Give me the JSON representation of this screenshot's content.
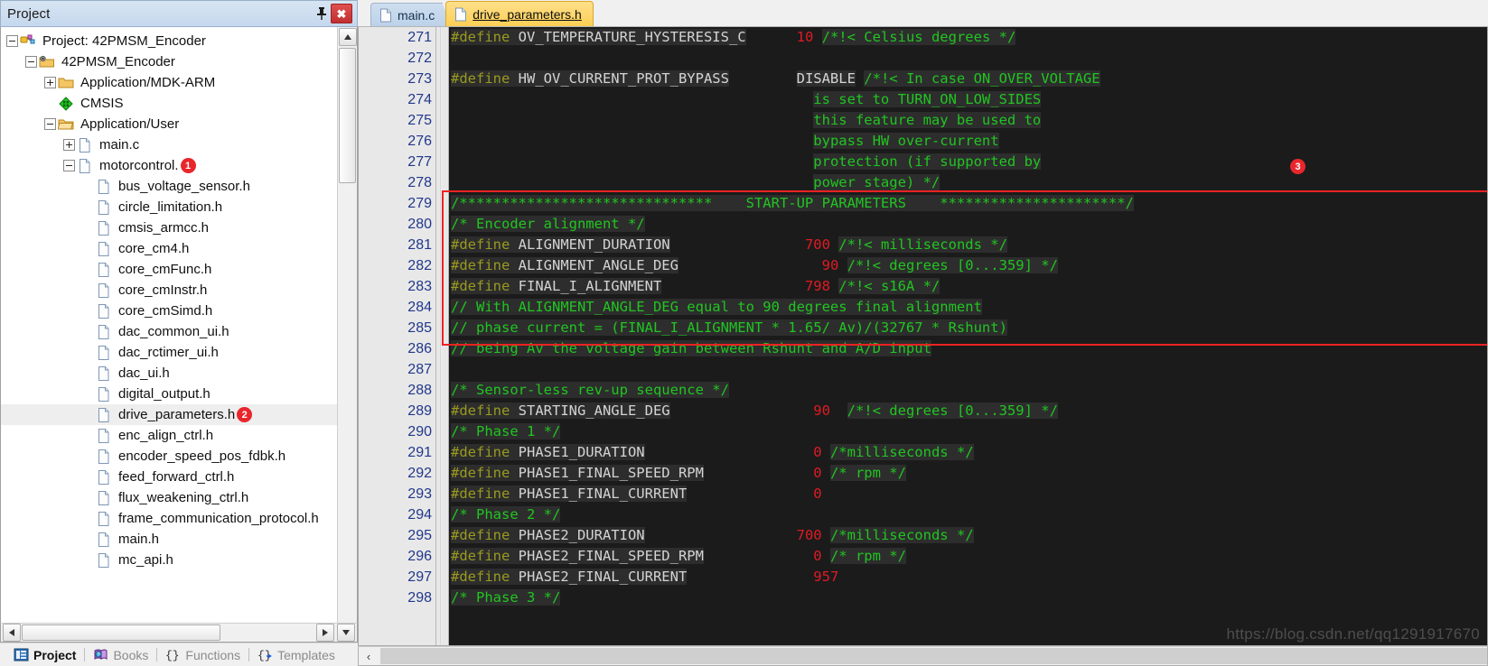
{
  "project_panel": {
    "title": "Project",
    "pin_icon": "pin-icon",
    "close_label": "✖",
    "tree": [
      {
        "depth": 0,
        "expander": "minus",
        "icon": "project-icon",
        "label": "Project: 42PMSM_Encoder"
      },
      {
        "depth": 1,
        "expander": "minus",
        "icon": "target-folder-icon",
        "label": "42PMSM_Encoder"
      },
      {
        "depth": 2,
        "expander": "plus",
        "icon": "folder-icon",
        "label": "Application/MDK-ARM"
      },
      {
        "depth": 2,
        "expander": "none",
        "icon": "cmsis-icon",
        "label": "CMSIS"
      },
      {
        "depth": 2,
        "expander": "minus",
        "icon": "folder-open-icon",
        "label": "Application/User"
      },
      {
        "depth": 3,
        "expander": "plus",
        "icon": "file-icon",
        "label": "main.c"
      },
      {
        "depth": 3,
        "expander": "minus",
        "icon": "file-icon",
        "label": "motorcontrol.",
        "badge": "1"
      },
      {
        "depth": 4,
        "expander": "none",
        "icon": "file-icon",
        "label": "bus_voltage_sensor.h"
      },
      {
        "depth": 4,
        "expander": "none",
        "icon": "file-icon",
        "label": "circle_limitation.h"
      },
      {
        "depth": 4,
        "expander": "none",
        "icon": "file-icon",
        "label": "cmsis_armcc.h"
      },
      {
        "depth": 4,
        "expander": "none",
        "icon": "file-icon",
        "label": "core_cm4.h"
      },
      {
        "depth": 4,
        "expander": "none",
        "icon": "file-icon",
        "label": "core_cmFunc.h"
      },
      {
        "depth": 4,
        "expander": "none",
        "icon": "file-icon",
        "label": "core_cmInstr.h"
      },
      {
        "depth": 4,
        "expander": "none",
        "icon": "file-icon",
        "label": "core_cmSimd.h"
      },
      {
        "depth": 4,
        "expander": "none",
        "icon": "file-icon",
        "label": "dac_common_ui.h"
      },
      {
        "depth": 4,
        "expander": "none",
        "icon": "file-icon",
        "label": "dac_rctimer_ui.h"
      },
      {
        "depth": 4,
        "expander": "none",
        "icon": "file-icon",
        "label": "dac_ui.h"
      },
      {
        "depth": 4,
        "expander": "none",
        "icon": "file-icon",
        "label": "digital_output.h"
      },
      {
        "depth": 4,
        "expander": "none",
        "icon": "file-icon",
        "label": "drive_parameters.h",
        "badge": "2",
        "selected": true
      },
      {
        "depth": 4,
        "expander": "none",
        "icon": "file-icon",
        "label": "enc_align_ctrl.h"
      },
      {
        "depth": 4,
        "expander": "none",
        "icon": "file-icon",
        "label": "encoder_speed_pos_fdbk.h"
      },
      {
        "depth": 4,
        "expander": "none",
        "icon": "file-icon",
        "label": "feed_forward_ctrl.h"
      },
      {
        "depth": 4,
        "expander": "none",
        "icon": "file-icon",
        "label": "flux_weakening_ctrl.h"
      },
      {
        "depth": 4,
        "expander": "none",
        "icon": "file-icon",
        "label": "frame_communication_protocol.h"
      },
      {
        "depth": 4,
        "expander": "none",
        "icon": "file-icon",
        "label": "main.h"
      },
      {
        "depth": 4,
        "expander": "none",
        "icon": "file-icon",
        "label": "mc_api.h"
      }
    ],
    "bottom_tabs": [
      {
        "label": "Project",
        "icon": "project-tab-icon",
        "active": true
      },
      {
        "label": "Books",
        "icon": "books-icon",
        "active": false
      },
      {
        "label": "Functions",
        "icon": "functions-icon",
        "active": false
      },
      {
        "label": "Templates",
        "icon": "templates-icon",
        "active": false
      }
    ]
  },
  "editor": {
    "tabs": [
      {
        "label": "main.c",
        "active": false
      },
      {
        "label": "drive_parameters.h",
        "active": true
      }
    ],
    "first_line_number": 271,
    "lines": [
      {
        "n": 271,
        "fold": "none",
        "tokens": [
          {
            "t": "kw",
            "v": "#define "
          },
          {
            "t": "id",
            "v": "OV_TEMPERATURE_HYSTERESIS_C"
          },
          {
            "t": "plain",
            "v": "      "
          },
          {
            "t": "num",
            "v": "10"
          },
          {
            "t": "plain",
            "v": " "
          },
          {
            "t": "cmt",
            "v": "/*!< Celsius degrees */"
          }
        ]
      },
      {
        "n": 272,
        "fold": "none",
        "tokens": []
      },
      {
        "n": 273,
        "fold": "start",
        "tokens": [
          {
            "t": "kw",
            "v": "#define "
          },
          {
            "t": "id",
            "v": "HW_OV_CURRENT_PROT_BYPASS"
          },
          {
            "t": "plain",
            "v": "        "
          },
          {
            "t": "id",
            "v": "DISABLE"
          },
          {
            "t": "plain",
            "v": " "
          },
          {
            "t": "cmt",
            "v": "/*!< In case ON_OVER_VOLTAGE"
          }
        ]
      },
      {
        "n": 274,
        "fold": "mid",
        "tokens": [
          {
            "t": "plain",
            "v": "                                           "
          },
          {
            "t": "cmt",
            "v": "is set to TURN_ON_LOW_SIDES"
          }
        ]
      },
      {
        "n": 275,
        "fold": "mid",
        "tokens": [
          {
            "t": "plain",
            "v": "                                           "
          },
          {
            "t": "cmt",
            "v": "this feature may be used to"
          }
        ]
      },
      {
        "n": 276,
        "fold": "mid",
        "tokens": [
          {
            "t": "plain",
            "v": "                                           "
          },
          {
            "t": "cmt",
            "v": "bypass HW over-current"
          }
        ]
      },
      {
        "n": 277,
        "fold": "mid",
        "tokens": [
          {
            "t": "plain",
            "v": "                                           "
          },
          {
            "t": "cmt",
            "v": "protection (if supported by"
          }
        ]
      },
      {
        "n": 278,
        "fold": "end",
        "tokens": [
          {
            "t": "plain",
            "v": "                                           "
          },
          {
            "t": "cmt",
            "v": "power stage) */"
          }
        ]
      },
      {
        "n": 279,
        "fold": "none",
        "tokens": [
          {
            "t": "cmt",
            "v": "/******************************    START-UP PARAMETERS    **********************/"
          }
        ]
      },
      {
        "n": 280,
        "fold": "none",
        "tokens": [
          {
            "t": "cmt",
            "v": "/* Encoder alignment */"
          }
        ]
      },
      {
        "n": 281,
        "fold": "none",
        "tokens": [
          {
            "t": "kw",
            "v": "#define "
          },
          {
            "t": "id",
            "v": "ALIGNMENT_DURATION"
          },
          {
            "t": "plain",
            "v": "                "
          },
          {
            "t": "num",
            "v": "700"
          },
          {
            "t": "plain",
            "v": " "
          },
          {
            "t": "cmt",
            "v": "/*!< milliseconds */"
          }
        ]
      },
      {
        "n": 282,
        "fold": "none",
        "tokens": [
          {
            "t": "kw",
            "v": "#define "
          },
          {
            "t": "id",
            "v": "ALIGNMENT_ANGLE_DEG"
          },
          {
            "t": "plain",
            "v": "                 "
          },
          {
            "t": "num",
            "v": "90"
          },
          {
            "t": "plain",
            "v": " "
          },
          {
            "t": "cmt",
            "v": "/*!< degrees [0...359] */"
          }
        ]
      },
      {
        "n": 283,
        "fold": "none",
        "tokens": [
          {
            "t": "kw",
            "v": "#define "
          },
          {
            "t": "id",
            "v": "FINAL_I_ALIGNMENT"
          },
          {
            "t": "plain",
            "v": "                 "
          },
          {
            "t": "num",
            "v": "798"
          },
          {
            "t": "plain",
            "v": " "
          },
          {
            "t": "cmt",
            "v": "/*!< s16A */"
          }
        ]
      },
      {
        "n": 284,
        "fold": "none",
        "tokens": [
          {
            "t": "cmt",
            "v": "// With ALIGNMENT_ANGLE_DEG equal to 90 degrees final alignment"
          }
        ]
      },
      {
        "n": 285,
        "fold": "none",
        "tokens": [
          {
            "t": "cmt",
            "v": "// phase current = (FINAL_I_ALIGNMENT * 1.65/ Av)/(32767 * Rshunt)"
          }
        ]
      },
      {
        "n": 286,
        "fold": "none",
        "tokens": [
          {
            "t": "cmt",
            "v": "// being Av the voltage gain between Rshunt and A/D input"
          }
        ]
      },
      {
        "n": 287,
        "fold": "none",
        "tokens": []
      },
      {
        "n": 288,
        "fold": "none",
        "tokens": [
          {
            "t": "cmt",
            "v": "/* Sensor-less rev-up sequence */"
          }
        ]
      },
      {
        "n": 289,
        "fold": "none",
        "tokens": [
          {
            "t": "kw",
            "v": "#define "
          },
          {
            "t": "id",
            "v": "STARTING_ANGLE_DEG"
          },
          {
            "t": "plain",
            "v": "                 "
          },
          {
            "t": "num",
            "v": "90"
          },
          {
            "t": "plain",
            "v": "  "
          },
          {
            "t": "cmt",
            "v": "/*!< degrees [0...359] */"
          }
        ]
      },
      {
        "n": 290,
        "fold": "none",
        "tokens": [
          {
            "t": "cmt",
            "v": "/* Phase 1 */"
          }
        ]
      },
      {
        "n": 291,
        "fold": "none",
        "tokens": [
          {
            "t": "kw",
            "v": "#define "
          },
          {
            "t": "id",
            "v": "PHASE1_DURATION"
          },
          {
            "t": "plain",
            "v": "                    "
          },
          {
            "t": "num",
            "v": "0"
          },
          {
            "t": "plain",
            "v": " "
          },
          {
            "t": "cmt",
            "v": "/*milliseconds */"
          }
        ]
      },
      {
        "n": 292,
        "fold": "none",
        "tokens": [
          {
            "t": "kw",
            "v": "#define "
          },
          {
            "t": "id",
            "v": "PHASE1_FINAL_SPEED_RPM"
          },
          {
            "t": "plain",
            "v": "             "
          },
          {
            "t": "num",
            "v": "0"
          },
          {
            "t": "plain",
            "v": " "
          },
          {
            "t": "cmt",
            "v": "/* rpm */"
          }
        ]
      },
      {
        "n": 293,
        "fold": "none",
        "tokens": [
          {
            "t": "kw",
            "v": "#define "
          },
          {
            "t": "id",
            "v": "PHASE1_FINAL_CURRENT"
          },
          {
            "t": "plain",
            "v": "               "
          },
          {
            "t": "num",
            "v": "0"
          }
        ]
      },
      {
        "n": 294,
        "fold": "none",
        "tokens": [
          {
            "t": "cmt",
            "v": "/* Phase 2 */"
          }
        ]
      },
      {
        "n": 295,
        "fold": "none",
        "tokens": [
          {
            "t": "kw",
            "v": "#define "
          },
          {
            "t": "id",
            "v": "PHASE2_DURATION"
          },
          {
            "t": "plain",
            "v": "                  "
          },
          {
            "t": "num",
            "v": "700"
          },
          {
            "t": "plain",
            "v": " "
          },
          {
            "t": "cmt",
            "v": "/*milliseconds */"
          }
        ]
      },
      {
        "n": 296,
        "fold": "none",
        "tokens": [
          {
            "t": "kw",
            "v": "#define "
          },
          {
            "t": "id",
            "v": "PHASE2_FINAL_SPEED_RPM"
          },
          {
            "t": "plain",
            "v": "             "
          },
          {
            "t": "num",
            "v": "0"
          },
          {
            "t": "plain",
            "v": " "
          },
          {
            "t": "cmt",
            "v": "/* rpm */"
          }
        ]
      },
      {
        "n": 297,
        "fold": "none",
        "tokens": [
          {
            "t": "kw",
            "v": "#define "
          },
          {
            "t": "id",
            "v": "PHASE2_FINAL_CURRENT"
          },
          {
            "t": "plain",
            "v": "               "
          },
          {
            "t": "num",
            "v": "957"
          }
        ]
      },
      {
        "n": 298,
        "fold": "none",
        "tokens": [
          {
            "t": "cmt",
            "v": "/* Phase 3 */"
          }
        ]
      }
    ],
    "annotation_badge": "3",
    "highlight_box_color": "#ef2222"
  },
  "watermark": "https://blog.csdn.net/qq1291917670",
  "colors": {
    "editor_bg": "#1b1b1b",
    "token_bg": "#2d2d2d",
    "keyword": "#9a9a20",
    "identifier": "#d4d4d4",
    "number": "#e01b24",
    "comment": "#21c521",
    "badge_red": "#e8262b",
    "gutter_number": "#21378b",
    "active_tab": "#fccf55"
  }
}
